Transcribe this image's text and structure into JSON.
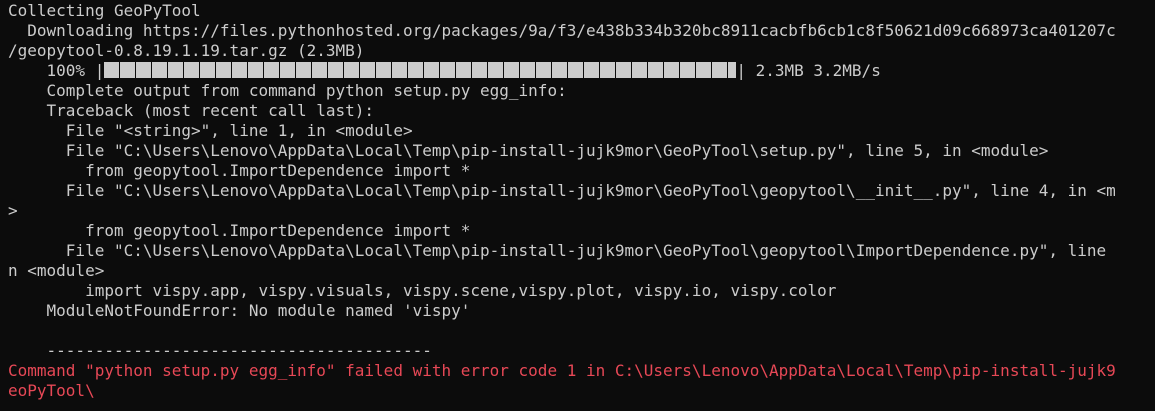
{
  "colors": {
    "background": "#0c0c0c",
    "text": "#cccccc",
    "error": "#e74856"
  },
  "console": {
    "collecting": "Collecting GeoPyTool",
    "downloading": "  Downloading https://files.pythonhosted.org/packages/9a/f3/e438b334b320bc8911cacbfb6cb1c8f50621d09c668973ca401207c",
    "download_cont": "/geopytool-0.8.19.1.19.tar.gz (2.3MB)",
    "progress_pct": "    100% |",
    "progress_end": "| 2.3MB 3.2MB/s",
    "progress_fraction": 1.0,
    "complete_output": "    Complete output from command python setup.py egg_info:",
    "traceback": "    Traceback (most recent call last):",
    "tb1": "      File \"<string>\", line 1, in <module>",
    "tb2": "      File \"C:\\Users\\Lenovo\\AppData\\Local\\Temp\\pip-install-jujk9mor\\GeoPyTool\\setup.py\", line 5, in <module>",
    "tb3": "        from geopytool.ImportDependence import *",
    "tb4": "      File \"C:\\Users\\Lenovo\\AppData\\Local\\Temp\\pip-install-jujk9mor\\GeoPyTool\\geopytool\\__init__.py\", line 4, in <m",
    "tb4_cont": ">",
    "tb5": "        from geopytool.ImportDependence import *",
    "tb6": "      File \"C:\\Users\\Lenovo\\AppData\\Local\\Temp\\pip-install-jujk9mor\\GeoPyTool\\geopytool\\ImportDependence.py\", line",
    "tb6_cont": "n <module>",
    "tb7": "        import vispy.app, vispy.visuals, vispy.scene,vispy.plot, vispy.io, vispy.color",
    "error": "    ModuleNotFoundError: No module named 'vispy'",
    "separator": "    ----------------------------------------",
    "command_failed": "Command \"python setup.py egg_info\" failed with error code 1 in C:\\Users\\Lenovo\\AppData\\Local\\Temp\\pip-install-jujk9",
    "command_failed_cont": "eoPyTool\\"
  }
}
